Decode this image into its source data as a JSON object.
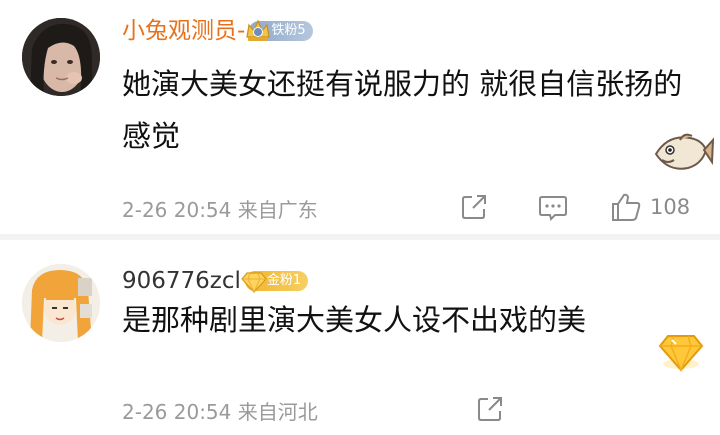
{
  "comments": [
    {
      "username": "小兔观测员-",
      "badge_text": "铁粉5",
      "text": "她演大美女还挺有说服力的 就很自信张扬的感觉",
      "time": "2-26 20:54",
      "location": "来自广东",
      "like_count": "108"
    },
    {
      "username": "906776zcl",
      "badge_text": "金粉1",
      "text": "是那种剧里演大美女人设不出戏的美",
      "time": "2-26 20:54",
      "location": "来自河北"
    }
  ],
  "colors": {
    "username_highlight": "#e8721c",
    "username_default": "#333333",
    "meta_gray": "#9a9a9a",
    "icon_gray": "#8a8a8a",
    "silver_badge": "#8fa9c9",
    "gold_badge": "#f0b52e"
  },
  "icons": [
    "share-icon",
    "comment-icon",
    "like-icon",
    "fish-sticker",
    "gold-diamond-sticker",
    "crown-badge-icon",
    "gem-badge-icon"
  ]
}
